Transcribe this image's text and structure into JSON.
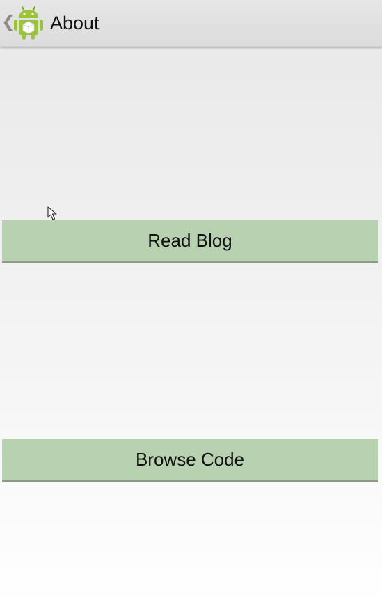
{
  "action_bar": {
    "title": "About",
    "up_icon": "chevron-left-icon",
    "app_icon": "android-robot-icon"
  },
  "buttons": {
    "read_blog_label": "Read Blog",
    "browse_code_label": "Browse Code"
  },
  "colors": {
    "button_bg": "#b8d1b0",
    "action_bar_bg": "#dcdcdc"
  }
}
